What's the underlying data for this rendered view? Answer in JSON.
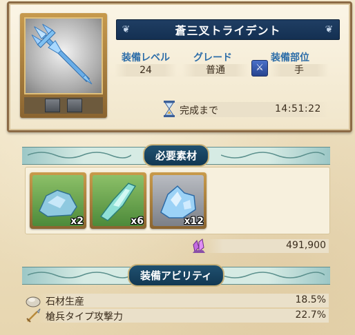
{
  "item": {
    "name": "蒼三叉トライデント",
    "icon": "trident-weapon-icon",
    "level_label": "装備レベル",
    "level_value": "24",
    "grade_label": "グレード",
    "grade_value": "普通",
    "slot_label": "装備部位",
    "slot_value": "手",
    "slot_icon": "sword-icon"
  },
  "timer": {
    "label": "完成まで",
    "value": "14:51:22",
    "icon": "hourglass-icon"
  },
  "materials": {
    "title": "必要素材",
    "items": [
      {
        "icon": "blue-ore-icon",
        "count": "x2"
      },
      {
        "icon": "crystal-shard-icon",
        "count": "x6"
      },
      {
        "icon": "ice-crystal-cluster-icon",
        "count": "x12"
      }
    ],
    "cost_icon": "purple-crystal-icon",
    "cost_value": "491,900"
  },
  "abilities": {
    "title": "装備アビリティ",
    "items": [
      {
        "icon": "stone-icon",
        "label": "石材生産",
        "value": "18.5%"
      },
      {
        "icon": "spear-icon",
        "label": "槍兵タイプ攻撃力",
        "value": "22.7%"
      }
    ]
  }
}
